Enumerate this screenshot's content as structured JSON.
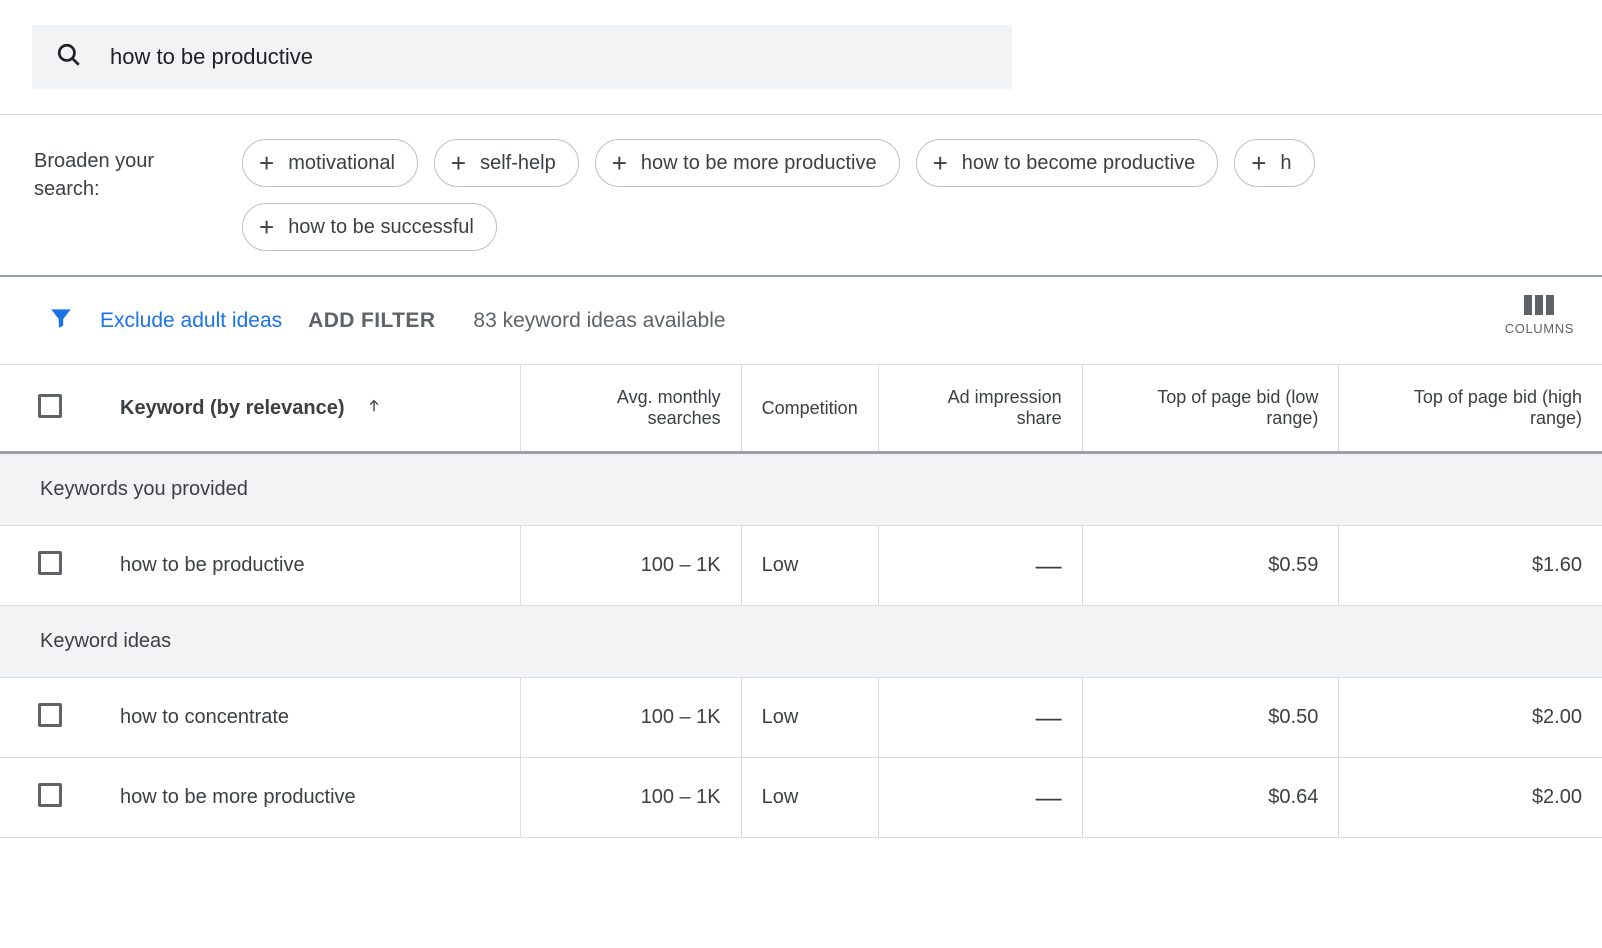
{
  "search": {
    "value": "how to be productive"
  },
  "broaden": {
    "label": "Broaden your search:",
    "chips": [
      "motivational",
      "self-help",
      "how to be more productive",
      "how to become productive",
      "h",
      "how to be successful"
    ]
  },
  "filter_row": {
    "exclude_label": "Exclude adult ideas",
    "add_filter_label": "ADD FILTER",
    "ideas_available": "83 keyword ideas available",
    "columns_label": "COLUMNS"
  },
  "columns": {
    "keyword": "Keyword (by relevance)",
    "avg_searches": "Avg. monthly searches",
    "competition": "Competition",
    "ad_share": "Ad impression share",
    "bid_low": "Top of page bid (low range)",
    "bid_high": "Top of page bid (high range)"
  },
  "sections": {
    "provided": "Keywords you provided",
    "ideas": "Keyword ideas"
  },
  "rows_provided": [
    {
      "keyword": "how to be productive",
      "avg": "100 – 1K",
      "comp": "Low",
      "share": "—",
      "low": "$0.59",
      "high": "$1.60"
    }
  ],
  "rows_ideas": [
    {
      "keyword": "how to concentrate",
      "avg": "100 – 1K",
      "comp": "Low",
      "share": "—",
      "low": "$0.50",
      "high": "$2.00"
    },
    {
      "keyword": "how to be more productive",
      "avg": "100 – 1K",
      "comp": "Low",
      "share": "—",
      "low": "$0.64",
      "high": "$2.00"
    }
  ]
}
